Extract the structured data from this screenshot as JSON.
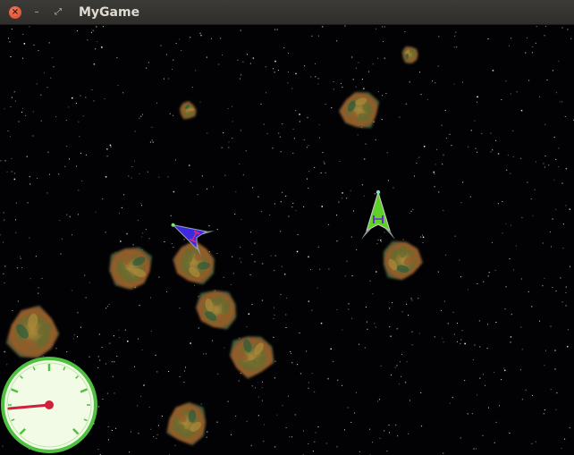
{
  "window": {
    "title": "MyGame",
    "close_glyph": "×",
    "minimize_glyph": "–",
    "maximize_glyph": "⤢"
  },
  "game": {
    "background_color": "#020205",
    "star_color": "#ffffff",
    "asteroid_colors": [
      "#6b6a2e",
      "#9a5a2a",
      "#2f5a3a",
      "#b08a3a"
    ],
    "player_ship": {
      "body_color": "#5fd02a",
      "accent_color": "#6a2fd0"
    },
    "enemy_ship": {
      "body_color": "#3b2be0",
      "accent_color": "#d02a7a"
    },
    "speedometer": {
      "level": 0.0,
      "face_color": "#f1fbe6",
      "rim_color": "#4fc040",
      "needle_color": "#d1203a"
    }
  }
}
